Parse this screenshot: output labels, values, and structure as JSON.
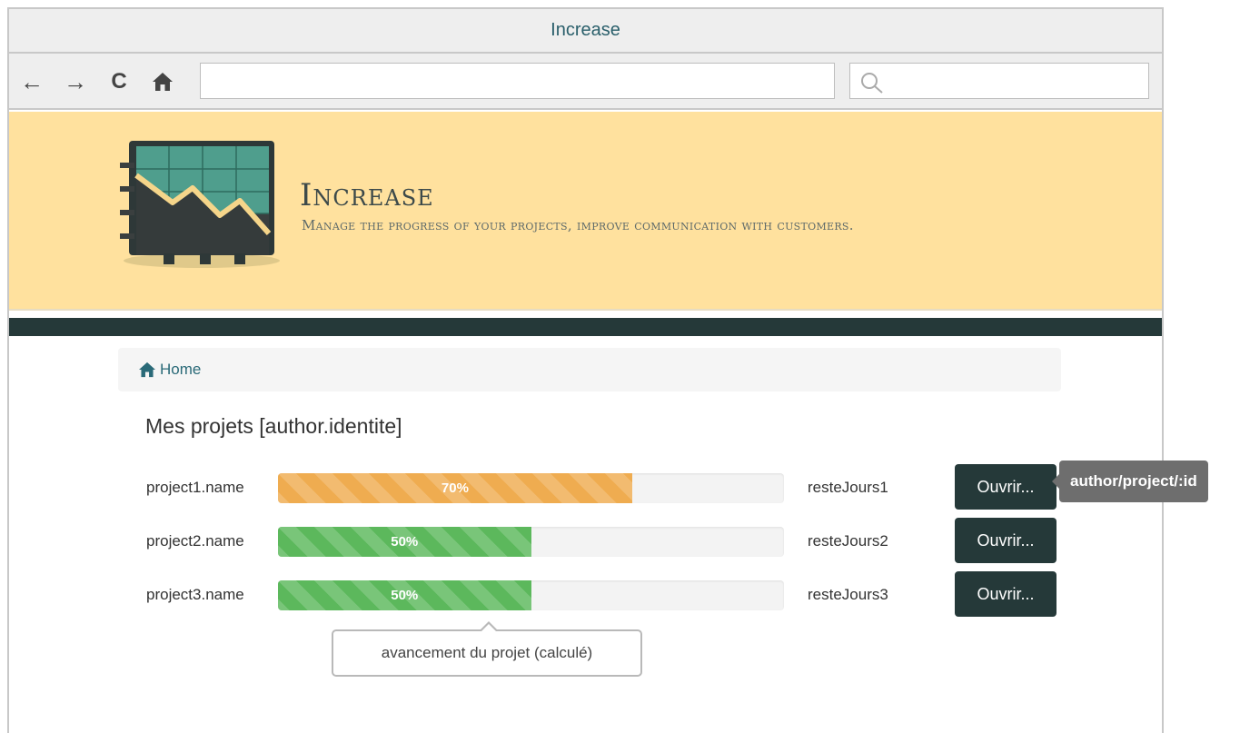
{
  "window": {
    "title": "Increase"
  },
  "toolbar": {
    "back_icon": "arrow-left-icon",
    "forward_icon": "arrow-right-icon",
    "reload_icon": "reload-icon",
    "home_icon": "home-icon",
    "url_value": "",
    "search_value": "",
    "search_icon": "search-icon"
  },
  "banner": {
    "title": "Increase",
    "subtitle": "Manage the progress of your projects, improve communication with customers.",
    "logo_icon": "chart-logo-icon",
    "background_color": "#ffe19e"
  },
  "breadcrumb": {
    "home_label": "Home",
    "home_icon": "home-icon"
  },
  "page": {
    "heading": "Mes projets [author.identite]"
  },
  "projects": [
    {
      "name": "project1.name",
      "progress": 70,
      "progress_label": "70%",
      "color": "#efac50",
      "reste": "resteJours1",
      "button": "Ouvrir..."
    },
    {
      "name": "project2.name",
      "progress": 50,
      "progress_label": "50%",
      "color": "#5cb85c",
      "reste": "resteJours2",
      "button": "Ouvrir..."
    },
    {
      "name": "project3.name",
      "progress": 50,
      "progress_label": "50%",
      "color": "#5cb85c",
      "reste": "resteJours3",
      "button": "Ouvrir..."
    }
  ],
  "tooltips": {
    "open_route": "author/project/:id",
    "progress_note": "avancement du projet (calculé)"
  },
  "colors": {
    "dark_accent": "#253939",
    "link": "#2a6a78"
  }
}
